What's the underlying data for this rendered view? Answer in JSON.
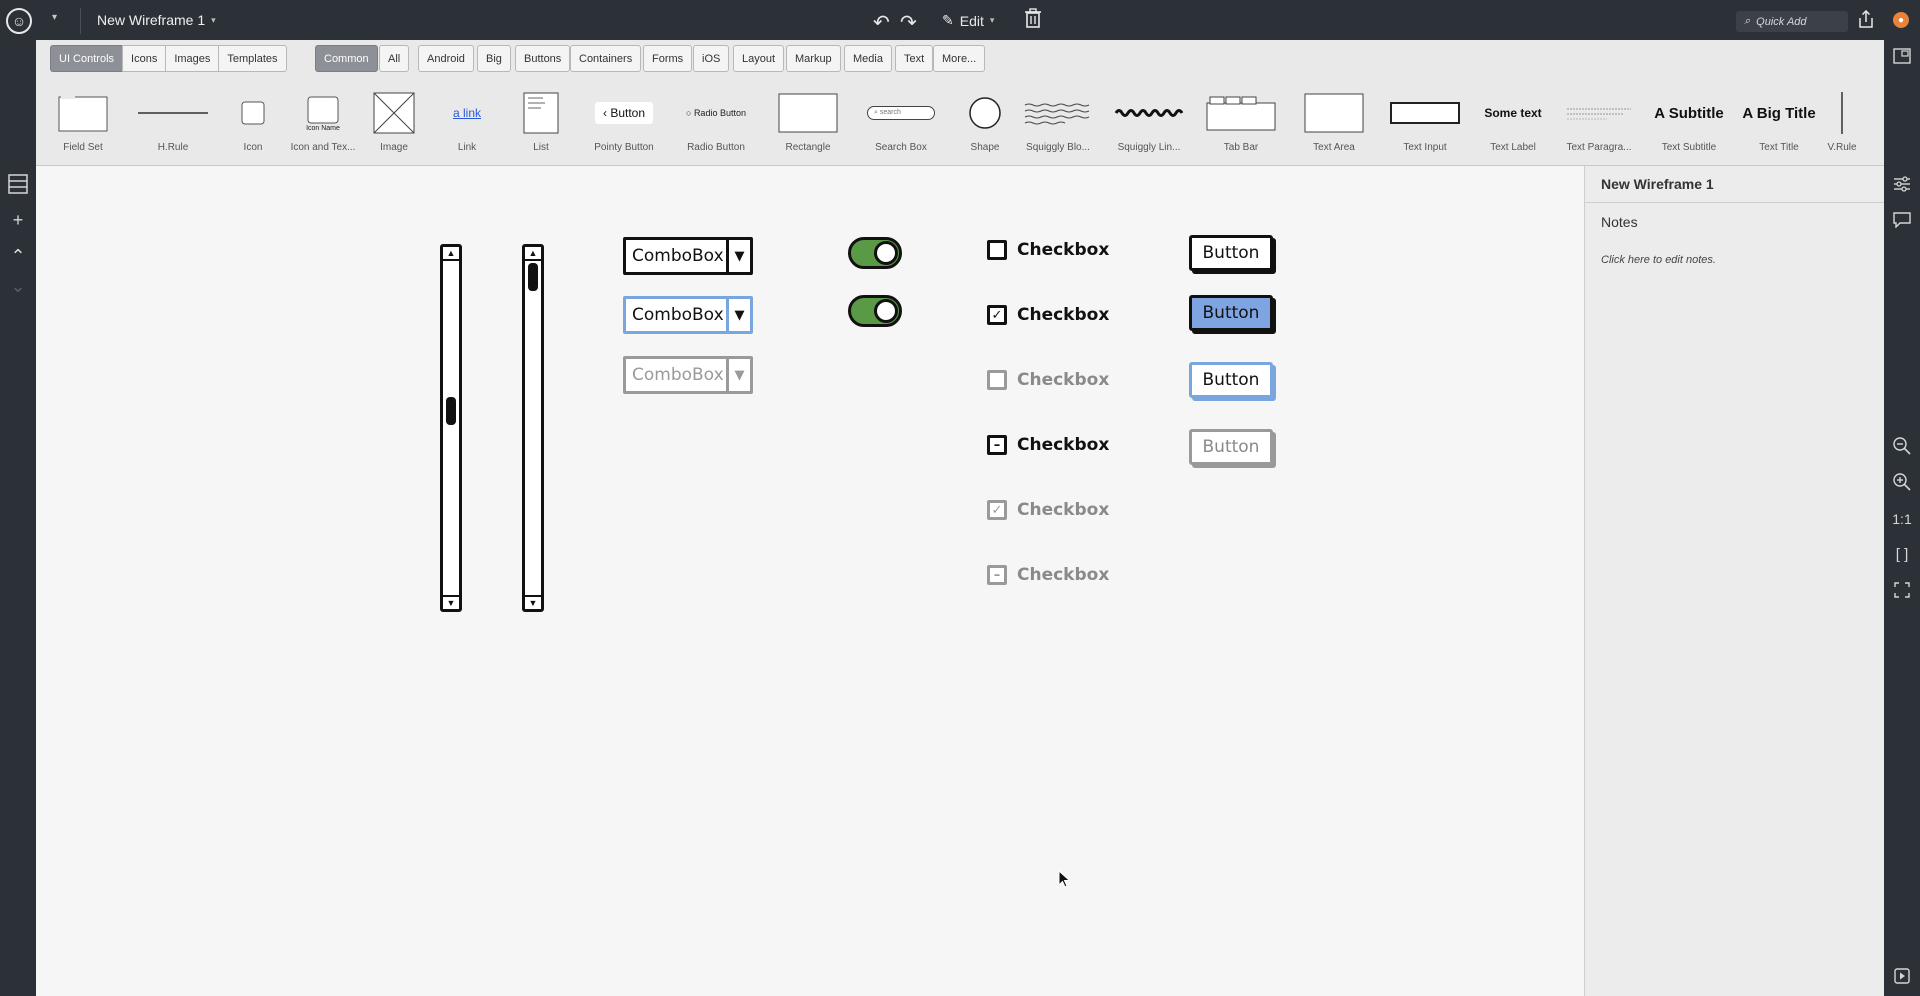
{
  "topbar": {
    "doc_title": "New Wireframe 1",
    "edit_label": "Edit",
    "quick_add_placeholder": "Quick Add",
    "icons": [
      "app-logo-icon",
      "undo-icon",
      "redo-icon",
      "pencil-icon",
      "trash-icon",
      "search-icon",
      "share-icon",
      "user-avatar-icon"
    ]
  },
  "library": {
    "source_tabs": [
      {
        "label": "UI Controls",
        "active": true
      },
      {
        "label": "Icons",
        "active": false
      },
      {
        "label": "Images",
        "active": false
      },
      {
        "label": "Templates",
        "active": false
      }
    ],
    "filter_tabs": [
      {
        "label": "Common",
        "active": true
      },
      {
        "label": "All",
        "active": false
      },
      {
        "label": "Android",
        "active": false
      },
      {
        "label": "Big",
        "active": false
      },
      {
        "label": "Buttons",
        "active": false
      },
      {
        "label": "Containers",
        "active": false
      },
      {
        "label": "Forms",
        "active": false
      },
      {
        "label": "iOS",
        "active": false
      },
      {
        "label": "Layout",
        "active": false
      },
      {
        "label": "Markup",
        "active": false
      },
      {
        "label": "Media",
        "active": false
      },
      {
        "label": "Text",
        "active": false
      },
      {
        "label": "More...",
        "active": false
      }
    ],
    "items": [
      {
        "label": "Field Set",
        "kind": "fieldset"
      },
      {
        "label": "H.Rule",
        "kind": "hrule"
      },
      {
        "label": "Icon",
        "kind": "icon"
      },
      {
        "label": "Icon and Tex...",
        "kind": "icontext",
        "thumb_text": "Icon Name"
      },
      {
        "label": "Image",
        "kind": "image"
      },
      {
        "label": "Link",
        "kind": "link",
        "thumb_text": "a link"
      },
      {
        "label": "List",
        "kind": "list"
      },
      {
        "label": "Pointy Button",
        "kind": "pointy",
        "thumb_text": "Button"
      },
      {
        "label": "Radio Button",
        "kind": "radio",
        "thumb_text": "Radio Button"
      },
      {
        "label": "Rectangle",
        "kind": "rect"
      },
      {
        "label": "Search Box",
        "kind": "search",
        "thumb_text": "search"
      },
      {
        "label": "Shape",
        "kind": "shape"
      },
      {
        "label": "Squiggly Blo...",
        "kind": "squigblock"
      },
      {
        "label": "Squiggly Lin...",
        "kind": "squigline"
      },
      {
        "label": "Tab Bar",
        "kind": "tabbar"
      },
      {
        "label": "Text Area",
        "kind": "textarea"
      },
      {
        "label": "Text Input",
        "kind": "textinput"
      },
      {
        "label": "Text Label",
        "kind": "textlabel",
        "thumb_text": "Some text"
      },
      {
        "label": "Text Paragra...",
        "kind": "paragraph"
      },
      {
        "label": "Text Subtitle",
        "kind": "subtitle",
        "thumb_text": "A Subtitle"
      },
      {
        "label": "Text Title",
        "kind": "title",
        "thumb_text": "A Big Title"
      },
      {
        "label": "V.Rule",
        "kind": "vrule"
      }
    ]
  },
  "canvas": {
    "comboboxes": [
      {
        "text": "ComboBox",
        "state": "normal"
      },
      {
        "text": "ComboBox",
        "state": "focus"
      },
      {
        "text": "ComboBox",
        "state": "disabled"
      }
    ],
    "checkboxes": [
      {
        "label": "Checkbox",
        "mark": "",
        "state": "normal"
      },
      {
        "label": "Checkbox",
        "mark": "✓",
        "state": "normal"
      },
      {
        "label": "Checkbox",
        "mark": "",
        "state": "disabled"
      },
      {
        "label": "Checkbox",
        "mark": "–",
        "state": "normal"
      },
      {
        "label": "Checkbox",
        "mark": "✓",
        "state": "disabled"
      },
      {
        "label": "Checkbox",
        "mark": "–",
        "state": "disabled"
      }
    ],
    "buttons": [
      {
        "label": "Button",
        "state": "normal"
      },
      {
        "label": "Button",
        "state": "selected"
      },
      {
        "label": "Button",
        "state": "focus"
      },
      {
        "label": "Button",
        "state": "disabled"
      }
    ],
    "accent_colors": {
      "toggle_on": "#5a9a46",
      "selected_button": "#7ea5e2",
      "focus": "#7aa6e0"
    }
  },
  "props": {
    "title": "New Wireframe 1",
    "notes_label": "Notes",
    "notes_hint": "Click here to edit notes."
  },
  "right_rail": {
    "zoom_reset_label": "1:1"
  }
}
